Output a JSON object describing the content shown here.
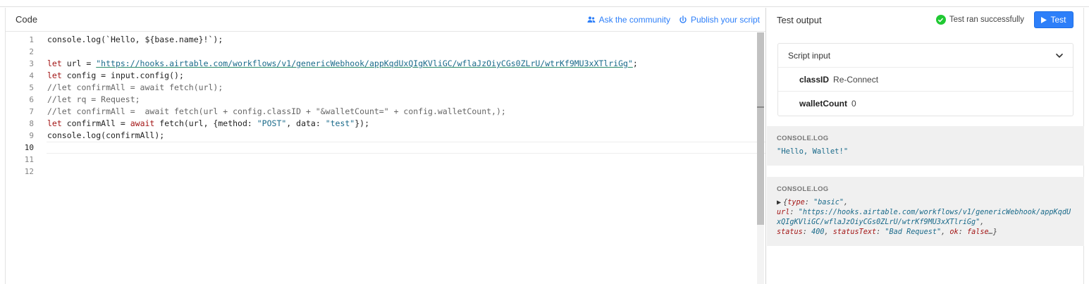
{
  "code": {
    "title": "Code",
    "actions": {
      "ask_community": "Ask the community",
      "publish_script": "Publish your script"
    },
    "line_numbers": [
      "1",
      "2",
      "3",
      "4",
      "5",
      "6",
      "7",
      "8",
      "9",
      "10",
      "11",
      "12"
    ],
    "active_line": 10,
    "lines": {
      "l1": "console.log(`Hello, ${base.name}!`);",
      "l3_kw": "let",
      "l3_pre": " url = ",
      "l3_url": "\"https://hooks.airtable.com/workflows/v1/genericWebhook/appKqdUxQIgKVliGC/wflaJzOiyCGs0ZLrU/wtrKf9MU3xXTlriGg\"",
      "l3_post": ";",
      "l4_kw": "let",
      "l4_rest": " config = input.config();",
      "l5": "//let confirmAll = await fetch(url);",
      "l6": "//let rq = Request;",
      "l7": "//let confirmAll =  await fetch(url + config.classID + \"&walletCount=\" + config.walletCount,);",
      "l8_kw": "let",
      "l8_a": " confirmAll = ",
      "l8_kw2": "await",
      "l8_b": " fetch(url, {method: ",
      "l8_s1": "\"POST\"",
      "l8_c": ", data: ",
      "l8_s2": "\"test\"",
      "l8_d": "});",
      "l9": "console.log(confirmAll);"
    }
  },
  "output": {
    "title": "Test output",
    "status": "Test ran successfully",
    "test_button": "Test",
    "script_input": {
      "title": "Script input",
      "fields": [
        {
          "key": "classID",
          "value": "Re-Connect"
        },
        {
          "key": "walletCount",
          "value": "0"
        }
      ]
    },
    "logs": [
      {
        "label": "CONSOLE.LOG",
        "text": "\"Hello, Wallet!\""
      },
      {
        "label": "CONSOLE.LOG",
        "obj": {
          "open": "{",
          "type_key": "type",
          "type_val": "\"basic\"",
          "url_key": "url",
          "url_val": "\"https://hooks.airtable.com/workflows/v1/genericWebhook/appKqdUxQIgKVliGC/wflaJzOiyCGs0ZLrU/wtrKf9MU3xXTlriGg\"",
          "status_key": "status",
          "status_val": "400",
          "statusText_key": "statusText",
          "statusText_val": "\"Bad Request\"",
          "ok_key": "ok",
          "ok_val": "false",
          "tail": "…}"
        }
      }
    ]
  },
  "icons": {
    "community": "people-icon",
    "publish": "publish-icon",
    "success": "check-circle-icon",
    "play": "play-icon",
    "expand": "chevron-down-icon"
  },
  "colors": {
    "accent": "#2d7ff9",
    "success": "#20c933",
    "keyword": "#a31515",
    "string": "#1a6a8a"
  }
}
